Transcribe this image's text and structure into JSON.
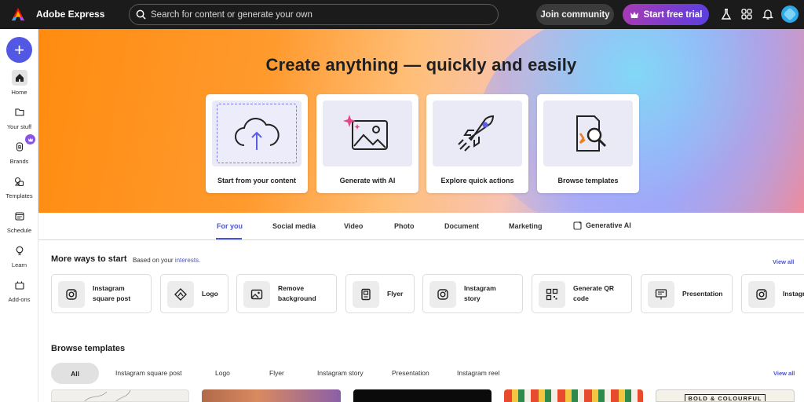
{
  "app": {
    "title": "Adobe Express"
  },
  "search": {
    "placeholder": "Search for content or generate your own"
  },
  "topbar": {
    "join_label": "Join community",
    "trial_label": "Start free trial",
    "icons": [
      "flask-icon",
      "apps-grid-icon",
      "bell-icon",
      "avatar"
    ]
  },
  "rail": {
    "create_label": "+",
    "items": [
      {
        "label": "Home",
        "icon": "home-icon"
      },
      {
        "label": "Your stuff",
        "icon": "folder-icon"
      },
      {
        "label": "Brands",
        "icon": "brand-icon"
      },
      {
        "label": "Templates",
        "icon": "templates-icon"
      },
      {
        "label": "Schedule",
        "icon": "calendar-icon"
      },
      {
        "label": "Learn",
        "icon": "lightbulb-icon"
      },
      {
        "label": "Add-ons",
        "icon": "addons-icon"
      }
    ]
  },
  "hero": {
    "title": "Create anything — quickly and easily",
    "cards": [
      {
        "label": "Start from your content",
        "icon": "cloud-upload-icon"
      },
      {
        "label": "Generate with AI",
        "icon": "ai-image-icon"
      },
      {
        "label": "Explore quick actions",
        "icon": "rocket-icon"
      },
      {
        "label": "Browse templates",
        "icon": "template-search-icon"
      }
    ]
  },
  "tabs": [
    {
      "label": "For you",
      "active": true
    },
    {
      "label": "Social media"
    },
    {
      "label": "Video"
    },
    {
      "label": "Photo"
    },
    {
      "label": "Document"
    },
    {
      "label": "Marketing"
    },
    {
      "label": "Generative AI"
    }
  ],
  "more_ways": {
    "title": "More ways to start",
    "subtitle_prefix": "Based on your",
    "subtitle_link": "interests.",
    "view_all": "View all",
    "items": [
      {
        "label": "Instagram square post",
        "icon": "instagram-icon"
      },
      {
        "label": "Logo",
        "icon": "logo-icon"
      },
      {
        "label": "Remove background",
        "icon": "remove-bg-icon"
      },
      {
        "label": "Flyer",
        "icon": "flyer-icon"
      },
      {
        "label": "Instagram story",
        "icon": "instagram-icon"
      },
      {
        "label": "Generate QR code",
        "icon": "qr-code-icon"
      },
      {
        "label": "Presentation",
        "icon": "presentation-icon"
      },
      {
        "label": "Instagr",
        "icon": "instagram-icon"
      }
    ]
  },
  "browse": {
    "title": "Browse templates",
    "view_all": "View all",
    "chips": [
      "All",
      "Instagram square post",
      "Logo",
      "Flyer",
      "Instagram story",
      "Presentation",
      "Instagram reel"
    ],
    "thumb_text": "BOLD & COLOURFUL"
  },
  "colors": {
    "accent": "#4953d8",
    "create_button": "#5258e4",
    "topbar": "#1b1b1b"
  }
}
